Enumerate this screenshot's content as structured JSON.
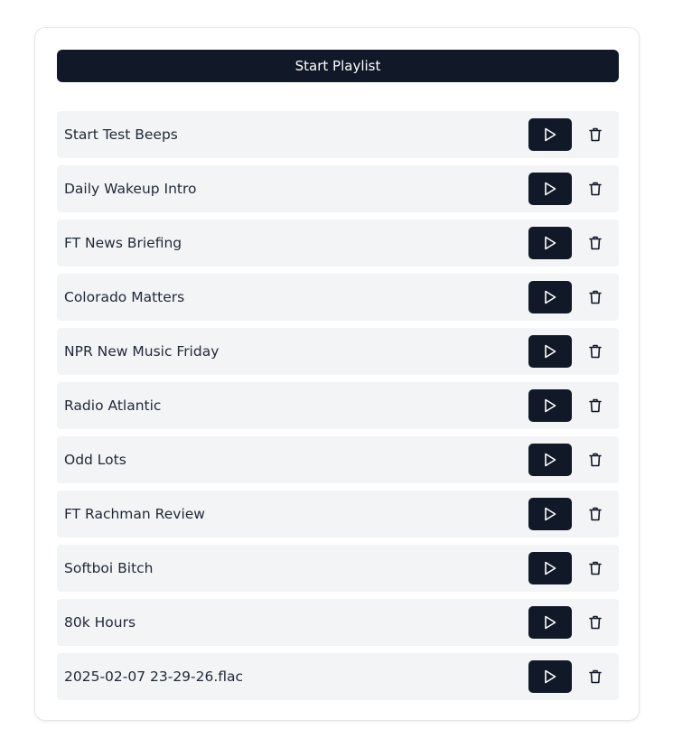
{
  "start_playlist_label": "Start Playlist",
  "colors": {
    "accent": "#111827",
    "row_background": "#f3f4f6",
    "text": "#1f2937"
  },
  "playlist": [
    {
      "label": "Start Test Beeps",
      "play_icon": "play-icon",
      "delete_icon": "trash-icon"
    },
    {
      "label": "Daily Wakeup Intro",
      "play_icon": "play-icon",
      "delete_icon": "trash-icon"
    },
    {
      "label": "FT News Briefing",
      "play_icon": "play-icon",
      "delete_icon": "trash-icon"
    },
    {
      "label": "Colorado Matters",
      "play_icon": "play-icon",
      "delete_icon": "trash-icon"
    },
    {
      "label": "NPR New Music Friday",
      "play_icon": "play-icon",
      "delete_icon": "trash-icon"
    },
    {
      "label": "Radio Atlantic",
      "play_icon": "play-icon",
      "delete_icon": "trash-icon"
    },
    {
      "label": "Odd Lots",
      "play_icon": "play-icon",
      "delete_icon": "trash-icon"
    },
    {
      "label": "FT Rachman Review",
      "play_icon": "play-icon",
      "delete_icon": "trash-icon"
    },
    {
      "label": "Softboi Bitch",
      "play_icon": "play-icon",
      "delete_icon": "trash-icon"
    },
    {
      "label": "80k Hours",
      "play_icon": "play-icon",
      "delete_icon": "trash-icon"
    },
    {
      "label": "2025-02-07 23-29-26.flac",
      "play_icon": "play-icon",
      "delete_icon": "trash-icon"
    }
  ]
}
